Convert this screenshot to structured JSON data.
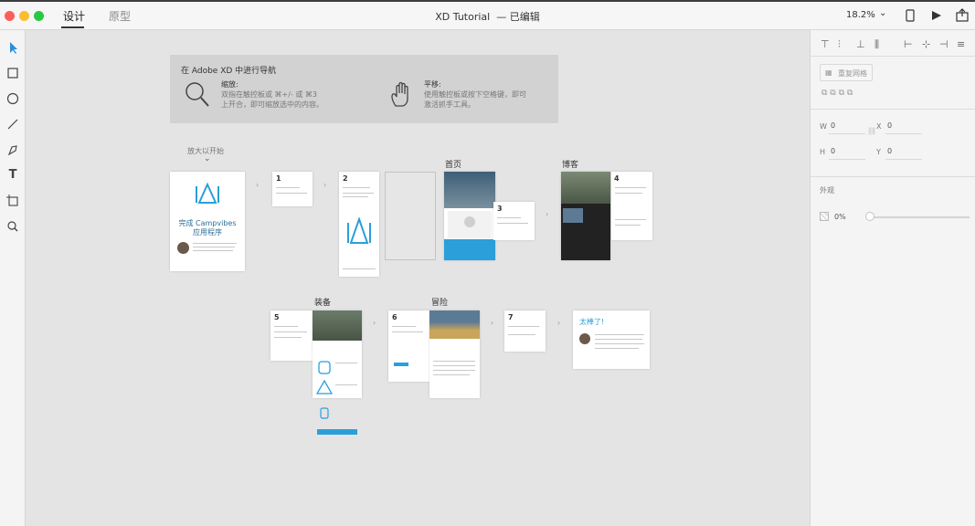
{
  "titlebar": {
    "tabs": [
      "设计",
      "原型"
    ],
    "title": "XD Tutorial",
    "status": "— 已编辑",
    "zoom": "18.2%"
  },
  "navbox": {
    "title": "在 Adobe XD 中进行导航",
    "zoom_heading": "缩放:",
    "zoom_text_1": "双指在触控板或 ⌘+/- 或 ⌘3",
    "zoom_text_2": "上开合，即可缩放选中的内容。",
    "pan_heading": "平移:",
    "pan_text_1": "使用触控板或按下空格键，即可",
    "pan_text_2": "激活抓手工具。"
  },
  "hint": "放大以开始",
  "artboards": {
    "home": "首页",
    "blog": "博客",
    "gear": "装备",
    "adventure": "冒险",
    "cover_title_1": "完成 Campvibes",
    "cover_title_2": "应用程序",
    "done": "太棒了!",
    "nums": [
      "1",
      "2",
      "3",
      "4",
      "5",
      "6",
      "7"
    ]
  },
  "rightpanel": {
    "repeat_grid": "重复网格",
    "w_label": "W",
    "w_val": "0",
    "x_label": "X",
    "x_val": "0",
    "h_label": "H",
    "h_val": "0",
    "y_label": "Y",
    "y_val": "0",
    "appearance": "外观",
    "opacity": "0%"
  },
  "colors": {
    "accent": "#2b9fd9",
    "card": "#ffffff",
    "canvas": "#e4e4e4"
  }
}
